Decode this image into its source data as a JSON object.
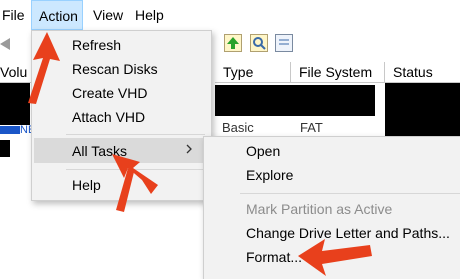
{
  "menubar": {
    "file": "File",
    "action": "Action",
    "view": "View",
    "help": "Help"
  },
  "volume_headers": {
    "volume": "Volu",
    "type": "Type",
    "file_system": "File System",
    "status": "Status"
  },
  "disk_row": {
    "type_fragment": "Basic",
    "fs_fragment": "FAT",
    "ne_fragment": "NE"
  },
  "action_menu": {
    "items": [
      "Refresh",
      "Rescan Disks",
      "Create VHD",
      "Attach VHD"
    ],
    "all_tasks": "All Tasks",
    "help": "Help"
  },
  "all_tasks_submenu": {
    "open": "Open",
    "explore": "Explore",
    "mark_active": "Mark Partition as Active",
    "change_drive": "Change Drive Letter and Paths...",
    "format": "Format..."
  },
  "colors": {
    "arrow": "#e8401c",
    "menu_highlight": "#cce8ff"
  }
}
